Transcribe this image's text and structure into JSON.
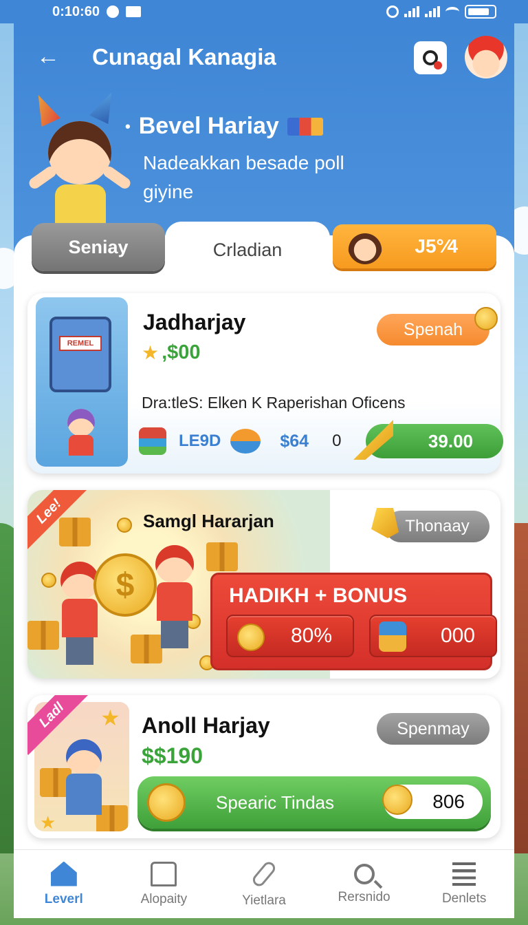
{
  "status_bar": {
    "time": "0:10:60"
  },
  "header": {
    "title": "Cunagal Kanagia",
    "hero_name": "Bevel Hariay",
    "hero_subtitle": "Nadeakkan besade poll giyine"
  },
  "tabs": [
    {
      "label": "Seniay"
    },
    {
      "label": "Crladian"
    },
    {
      "label": "J5°⁄4"
    }
  ],
  "cards": [
    {
      "title": "Jadharjay",
      "price": ",$00",
      "button": "Spenah",
      "machine_sign": "REMEL",
      "description": "Dra:tleS: Elken K Raperishan Oficens",
      "stats": {
        "lego": "LE9D",
        "price": "$64",
        "zero": "0",
        "amount": "39.00"
      }
    },
    {
      "ribbon": "Lee!",
      "title": "Samgl Hararjan",
      "button": "Thonaay",
      "coin_symbol": "$",
      "bonus_title": "HADIKH + BONUS",
      "bonus_left": "80%",
      "bonus_right": "000"
    },
    {
      "ribbon": "Ladl",
      "title": "Anoll Harjay",
      "price": "$$190",
      "button": "Spenmay",
      "green_label": "Spearic Tindas",
      "count": "806"
    }
  ],
  "bottom_nav": [
    {
      "label": "Leverl",
      "icon": "home-icon",
      "active": true
    },
    {
      "label": "Alopaity",
      "icon": "home-outline-icon",
      "active": false
    },
    {
      "label": "Yietlara",
      "icon": "paperclip-icon",
      "active": false
    },
    {
      "label": "Rersnido",
      "icon": "search-icon",
      "active": false
    },
    {
      "label": "Denlets",
      "icon": "menu-icon",
      "active": false
    }
  ],
  "colors": {
    "primary_blue": "#3f86d6",
    "orange": "#f79a1f",
    "green": "#3aa43a",
    "red_panel": "#d4302a"
  }
}
